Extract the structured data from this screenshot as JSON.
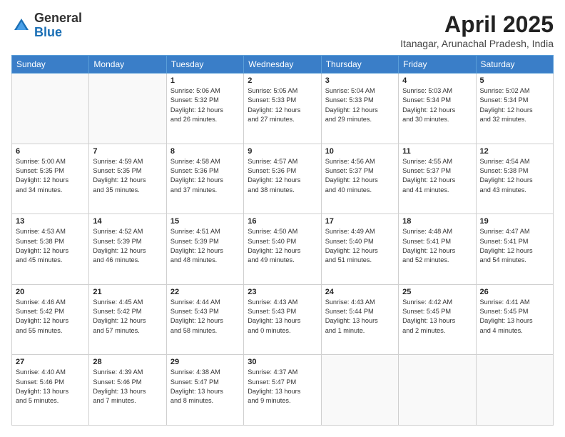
{
  "logo": {
    "general": "General",
    "blue": "Blue"
  },
  "title": {
    "month": "April 2025",
    "location": "Itanagar, Arunachal Pradesh, India"
  },
  "headers": [
    "Sunday",
    "Monday",
    "Tuesday",
    "Wednesday",
    "Thursday",
    "Friday",
    "Saturday"
  ],
  "weeks": [
    [
      {
        "day": "",
        "info": ""
      },
      {
        "day": "",
        "info": ""
      },
      {
        "day": "1",
        "info": "Sunrise: 5:06 AM\nSunset: 5:32 PM\nDaylight: 12 hours\nand 26 minutes."
      },
      {
        "day": "2",
        "info": "Sunrise: 5:05 AM\nSunset: 5:33 PM\nDaylight: 12 hours\nand 27 minutes."
      },
      {
        "day": "3",
        "info": "Sunrise: 5:04 AM\nSunset: 5:33 PM\nDaylight: 12 hours\nand 29 minutes."
      },
      {
        "day": "4",
        "info": "Sunrise: 5:03 AM\nSunset: 5:34 PM\nDaylight: 12 hours\nand 30 minutes."
      },
      {
        "day": "5",
        "info": "Sunrise: 5:02 AM\nSunset: 5:34 PM\nDaylight: 12 hours\nand 32 minutes."
      }
    ],
    [
      {
        "day": "6",
        "info": "Sunrise: 5:00 AM\nSunset: 5:35 PM\nDaylight: 12 hours\nand 34 minutes."
      },
      {
        "day": "7",
        "info": "Sunrise: 4:59 AM\nSunset: 5:35 PM\nDaylight: 12 hours\nand 35 minutes."
      },
      {
        "day": "8",
        "info": "Sunrise: 4:58 AM\nSunset: 5:36 PM\nDaylight: 12 hours\nand 37 minutes."
      },
      {
        "day": "9",
        "info": "Sunrise: 4:57 AM\nSunset: 5:36 PM\nDaylight: 12 hours\nand 38 minutes."
      },
      {
        "day": "10",
        "info": "Sunrise: 4:56 AM\nSunset: 5:37 PM\nDaylight: 12 hours\nand 40 minutes."
      },
      {
        "day": "11",
        "info": "Sunrise: 4:55 AM\nSunset: 5:37 PM\nDaylight: 12 hours\nand 41 minutes."
      },
      {
        "day": "12",
        "info": "Sunrise: 4:54 AM\nSunset: 5:38 PM\nDaylight: 12 hours\nand 43 minutes."
      }
    ],
    [
      {
        "day": "13",
        "info": "Sunrise: 4:53 AM\nSunset: 5:38 PM\nDaylight: 12 hours\nand 45 minutes."
      },
      {
        "day": "14",
        "info": "Sunrise: 4:52 AM\nSunset: 5:39 PM\nDaylight: 12 hours\nand 46 minutes."
      },
      {
        "day": "15",
        "info": "Sunrise: 4:51 AM\nSunset: 5:39 PM\nDaylight: 12 hours\nand 48 minutes."
      },
      {
        "day": "16",
        "info": "Sunrise: 4:50 AM\nSunset: 5:40 PM\nDaylight: 12 hours\nand 49 minutes."
      },
      {
        "day": "17",
        "info": "Sunrise: 4:49 AM\nSunset: 5:40 PM\nDaylight: 12 hours\nand 51 minutes."
      },
      {
        "day": "18",
        "info": "Sunrise: 4:48 AM\nSunset: 5:41 PM\nDaylight: 12 hours\nand 52 minutes."
      },
      {
        "day": "19",
        "info": "Sunrise: 4:47 AM\nSunset: 5:41 PM\nDaylight: 12 hours\nand 54 minutes."
      }
    ],
    [
      {
        "day": "20",
        "info": "Sunrise: 4:46 AM\nSunset: 5:42 PM\nDaylight: 12 hours\nand 55 minutes."
      },
      {
        "day": "21",
        "info": "Sunrise: 4:45 AM\nSunset: 5:42 PM\nDaylight: 12 hours\nand 57 minutes."
      },
      {
        "day": "22",
        "info": "Sunrise: 4:44 AM\nSunset: 5:43 PM\nDaylight: 12 hours\nand 58 minutes."
      },
      {
        "day": "23",
        "info": "Sunrise: 4:43 AM\nSunset: 5:43 PM\nDaylight: 13 hours\nand 0 minutes."
      },
      {
        "day": "24",
        "info": "Sunrise: 4:43 AM\nSunset: 5:44 PM\nDaylight: 13 hours\nand 1 minute."
      },
      {
        "day": "25",
        "info": "Sunrise: 4:42 AM\nSunset: 5:45 PM\nDaylight: 13 hours\nand 2 minutes."
      },
      {
        "day": "26",
        "info": "Sunrise: 4:41 AM\nSunset: 5:45 PM\nDaylight: 13 hours\nand 4 minutes."
      }
    ],
    [
      {
        "day": "27",
        "info": "Sunrise: 4:40 AM\nSunset: 5:46 PM\nDaylight: 13 hours\nand 5 minutes."
      },
      {
        "day": "28",
        "info": "Sunrise: 4:39 AM\nSunset: 5:46 PM\nDaylight: 13 hours\nand 7 minutes."
      },
      {
        "day": "29",
        "info": "Sunrise: 4:38 AM\nSunset: 5:47 PM\nDaylight: 13 hours\nand 8 minutes."
      },
      {
        "day": "30",
        "info": "Sunrise: 4:37 AM\nSunset: 5:47 PM\nDaylight: 13 hours\nand 9 minutes."
      },
      {
        "day": "",
        "info": ""
      },
      {
        "day": "",
        "info": ""
      },
      {
        "day": "",
        "info": ""
      }
    ]
  ]
}
